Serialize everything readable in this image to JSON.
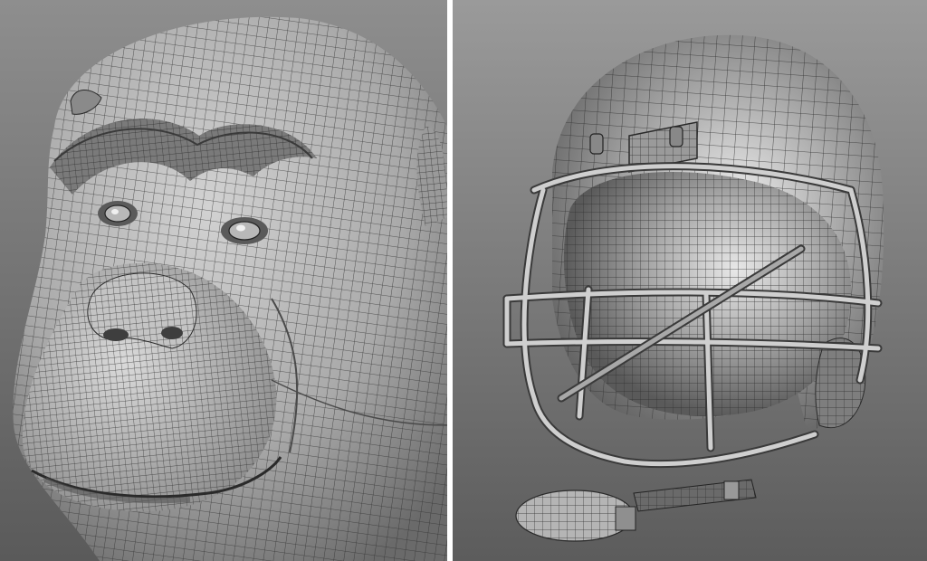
{
  "panels": [
    {
      "subject": "chimpanzee-head-wireframe"
    },
    {
      "subject": "football-helmet-wireframe"
    }
  ],
  "colors": {
    "viewport_bg_top": "#8c8c8c",
    "viewport_bg_bottom": "#5e5e5e",
    "divider": "#ffffff",
    "wire": "#2a2a2a",
    "surface_light": "#cfcfcf",
    "surface_dark": "#6f6f6f"
  }
}
